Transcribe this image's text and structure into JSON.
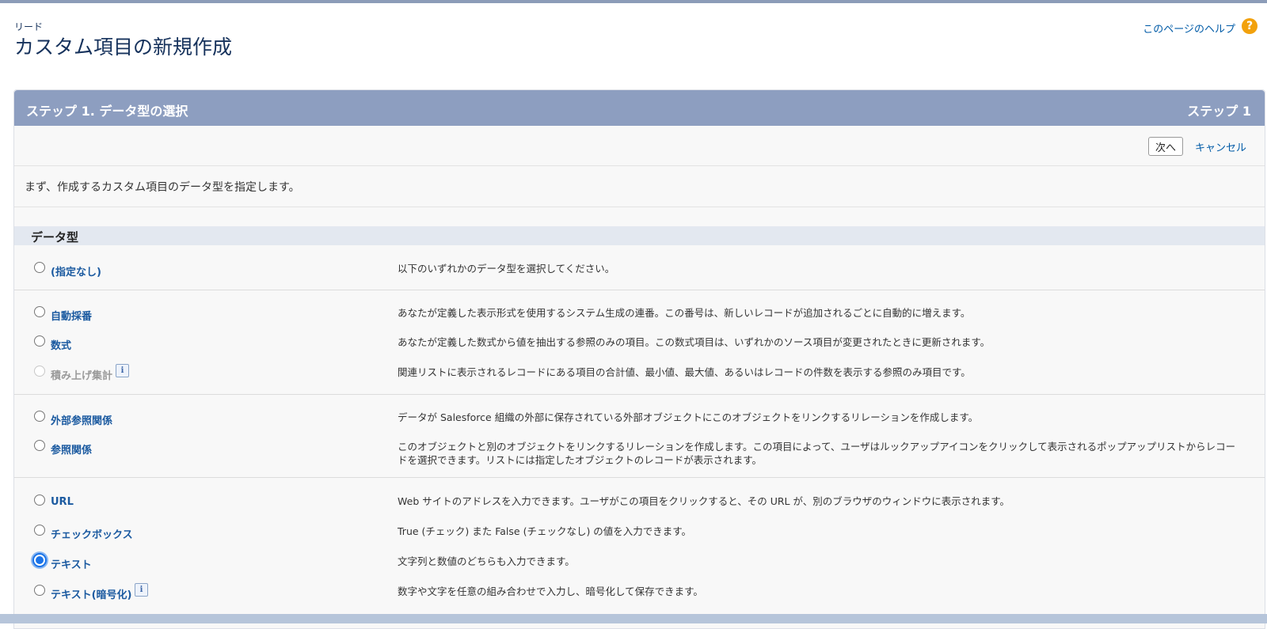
{
  "header": {
    "object_label": "リード",
    "title": "カスタム項目の新規作成",
    "help_link": "このページのヘルプ",
    "help_icon_glyph": "?"
  },
  "panel": {
    "title": "ステップ 1. データ型の選択",
    "step": "ステップ 1",
    "next_button": "次へ",
    "cancel_link": "キャンセル",
    "intro": "まず、作成するカスタム項目のデータ型を指定します。",
    "section_label": "データ型"
  },
  "colors": {
    "panel_header": "#8d9ec0",
    "link": "#015ba7",
    "help_icon": "#f2a10c",
    "selected_radio": "#1a73e8"
  },
  "options": [
    {
      "label": "(指定なし)",
      "desc": "以下のいずれかのデータ型を選択してください。",
      "selected": false,
      "disabled": false,
      "info": false
    },
    {
      "label": "自動採番",
      "desc": "あなたが定義した表示形式を使用するシステム生成の連番。この番号は、新しいレコードが追加されるごとに自動的に増えます。",
      "selected": false,
      "disabled": false,
      "info": false
    },
    {
      "label": "数式",
      "desc": "あなたが定義した数式から値を抽出する参照のみの項目。この数式項目は、いずれかのソース項目が変更されたときに更新されます。",
      "selected": false,
      "disabled": false,
      "info": false
    },
    {
      "label": "積み上げ集計",
      "desc": "関連リストに表示されるレコードにある項目の合計値、最小値、最大値、あるいはレコードの件数を表示する参照のみ項目です。",
      "selected": false,
      "disabled": true,
      "info": true
    },
    {
      "label": "外部参照関係",
      "desc": "データが Salesforce 組織の外部に保存されている外部オブジェクトにこのオブジェクトをリンクするリレーションを作成します。",
      "selected": false,
      "disabled": false,
      "info": false
    },
    {
      "label": "参照関係",
      "desc": "このオブジェクトと別のオブジェクトをリンクするリレーションを作成します。この項目によって、ユーザはルックアップアイコンをクリックして表示されるポップアップリストからレコードを選択できます。リストには指定したオブジェクトのレコードが表示されます。",
      "selected": false,
      "disabled": false,
      "info": false
    },
    {
      "label": "URL",
      "desc": "Web サイトのアドレスを入力できます。ユーザがこの項目をクリックすると、その URL が、別のブラウザのウィンドウに表示されます。",
      "selected": false,
      "disabled": false,
      "info": false
    },
    {
      "label": "チェックボックス",
      "desc": "True (チェック) また False (チェックなし) の値を入力できます。",
      "selected": false,
      "disabled": false,
      "info": false
    },
    {
      "label": "テキスト",
      "desc": "文字列と数値のどちらも入力できます。",
      "selected": true,
      "disabled": false,
      "info": false
    },
    {
      "label": "テキスト(暗号化)",
      "desc": "数字や文字を任意の組み合わせで入力し、暗号化して保存できます。",
      "selected": false,
      "disabled": false,
      "info": true
    }
  ],
  "info_glyph": "i"
}
